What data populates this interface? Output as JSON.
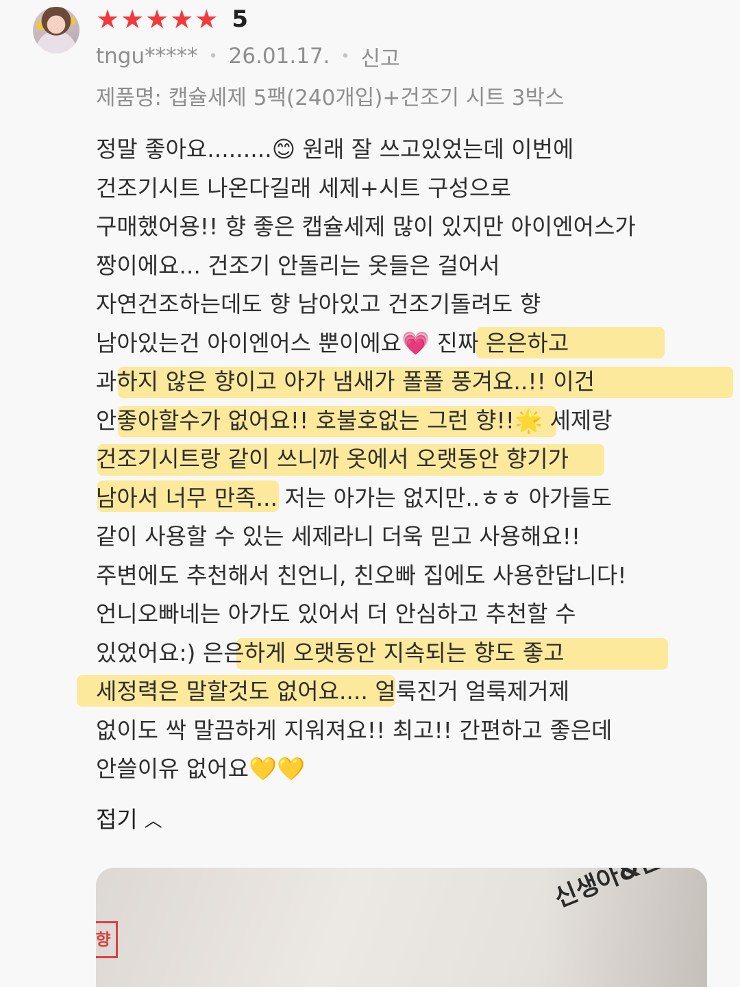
{
  "review": {
    "rating": {
      "stars_filled": 5,
      "stars_total": 5,
      "star_color": "#f23a3c",
      "value": "5"
    },
    "author": "tngu*****",
    "date": "26.01.17.",
    "report_label": "신고",
    "product_name": "제품명: 캡슐세제 5팩(240개입)+건조기 시트 3박스",
    "highlight_color": "#ffdc50",
    "body_lines": [
      "정말 좋아요.........😊 원래 잘 쓰고있었는데 이번에",
      "건조기시트 나온다길래 세제+시트 구성으로",
      "구매했어용!! 향 좋은 캡슐세제 많이 있지만 아이엔어스가",
      "짱이에요... 건조기 안돌리는 옷들은 걸어서",
      "자연건조하는데도 향 남아있고 건조기돌려도 향",
      "남아있는건 아이엔어스 뿐이에요💗 진짜 은은하고",
      "과하지 않은 향이고 아가 냄새가 폴폴 풍겨요..!! 이건",
      "안좋아할수가 없어요!! 호불호없는 그런 향!!🌟 세제랑",
      "건조기시트랑 같이 쓰니까 옷에서 오랫동안 향기가",
      "남아서 너무 만족... 저는 아가는 없지만..ㅎㅎ 아가들도",
      "같이 사용할 수 있는 세제라니 더욱 믿고 사용해요!!",
      "주변에도 추천해서 친언니, 친오빠 집에도 사용한답니다!",
      "언니오빠네는 아가도 있어서 더 안심하고 추천할 수",
      "있었어요:) 은은하게 오랫동안 지속되는 향도 좋고",
      "세정력은 말할것도 없어요.... 얼룩진거 얼룩제거제",
      "없이도 싹 말끔하게 지워져요!! 최고!! 간편하고 좋은데",
      "안쓸이유 없어요💛💛"
    ],
    "collapse_label": "접기",
    "photo": {
      "tag_text": "향",
      "package_text": "신생아&온가족 민감"
    }
  }
}
